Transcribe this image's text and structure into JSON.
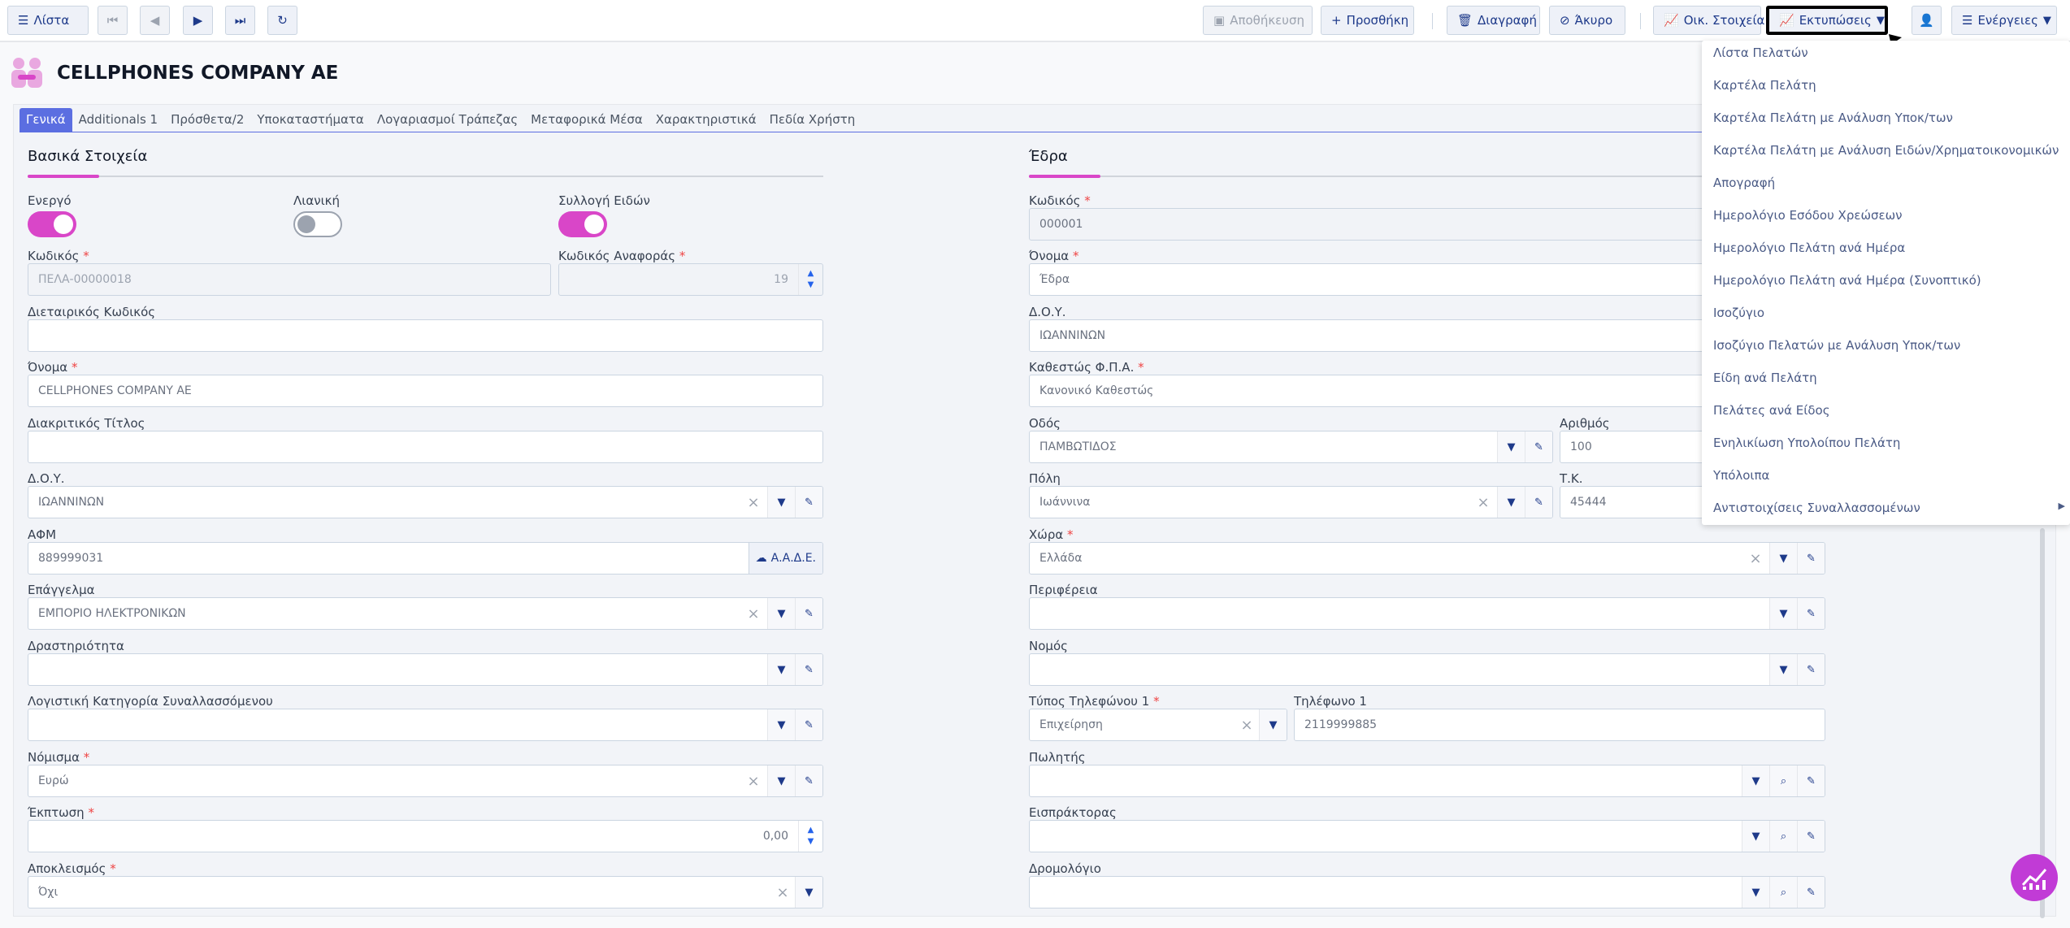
{
  "toolbar": {
    "list_label": "Λίστα",
    "save_label": "Αποθήκευση",
    "add_label": "Προσθήκη",
    "delete_label": "Διαγραφή",
    "cancel_label": "Άκυρο",
    "financial_label": "Οικ. Στοιχεία",
    "prints_label": "Εκτυπώσεις",
    "actions_label": "Ενέργειες"
  },
  "header": {
    "title": "CELLPHONES COMPANY AE"
  },
  "tabs": [
    "Γενικά",
    "Additionals 1",
    "Πρόσθετα/2",
    "Υποκαταστήματα",
    "Λογαριασμοί Τράπεζας",
    "Μεταφορικά Μέσα",
    "Χαρακτηριστικά",
    "Πεδία Χρήστη"
  ],
  "basic": {
    "section_title": "Βασικά Στοιχεία",
    "active_label": "Ενεργό",
    "retail_label": "Λιανική",
    "collect_label": "Συλλογή Ειδών",
    "active_on": true,
    "retail_on": false,
    "collect_on": true,
    "code_label": "Κωδικός",
    "code_value": "ΠΕΛΑ-00000018",
    "refcode_label": "Κωδικός Αναφοράς",
    "refcode_value": "19",
    "intercode_label": "Διεταιρικός Κωδικός",
    "intercode_value": "",
    "name_label": "Όνομα",
    "name_value": "CELLPHONES COMPANY AE",
    "distinct_label": "Διακριτικός Τίτλος",
    "distinct_value": "",
    "doy_label": "Δ.Ο.Υ.",
    "doy_value": "ΙΩΑΝΝΙΝΩΝ",
    "afm_label": "ΑΦΜ",
    "afm_value": "889999031",
    "aade_label": "Α.Α.Δ.Ε.",
    "profession_label": "Επάγγελμα",
    "profession_value": "ΕΜΠΟΡΙΟ ΗΛΕΚΤΡΟΝΙΚΩΝ",
    "activity_label": "Δραστηριότητα",
    "activity_value": "",
    "acc_cat_label": "Λογιστική Κατηγορία Συναλλασσόμενου",
    "acc_cat_value": "",
    "currency_label": "Νόμισμα",
    "currency_value": "Ευρώ",
    "discount_label": "Έκπτωση",
    "discount_value": "0,00",
    "exclusion_label": "Αποκλεισμός",
    "exclusion_value": "Όχι"
  },
  "seat": {
    "section_title": "Έδρα",
    "code_label": "Κωδικός",
    "code_value": "000001",
    "name_label": "Όνομα",
    "name_value": "Έδρα",
    "doy_label": "Δ.Ο.Υ.",
    "doy_value": "ΙΩΑΝΝΙΝΩΝ",
    "vat_label": "Καθεστώς Φ.Π.Α.",
    "vat_value": "Κανονικό Καθεστώς",
    "street_label": "Οδός",
    "street_value": "ΠΑΜΒΩΤΙΔΟΣ",
    "number_label": "Αριθμός",
    "number_value": "100",
    "city_label": "Πόλη",
    "city_value": "Ιωάννινα",
    "zip_label": "Τ.Κ.",
    "zip_value": "45444",
    "country_label": "Χώρα",
    "country_value": "Ελλάδα",
    "region_label": "Περιφέρεια",
    "region_value": "",
    "prefecture_label": "Νομός",
    "prefecture_value": "",
    "phone_type_label": "Τύπος Τηλεφώνου 1",
    "phone_type_value": "Επιχείρηση",
    "phone_label": "Τηλέφωνο 1",
    "phone_value": "2119999885",
    "seller_label": "Πωλητής",
    "seller_value": "",
    "collector_label": "Εισπράκτορας",
    "collector_value": "",
    "route_label": "Δρομολόγιο",
    "route_value": ""
  },
  "print_menu": {
    "items": [
      "Λίστα Πελατών",
      "Καρτέλα Πελάτη",
      "Καρτέλα Πελάτη με Ανάλυση Υποκ/των",
      "Καρτέλα Πελάτη με Ανάλυση Ειδών/Χρηματοικονομικών",
      "Απογραφή",
      "Ημερολόγιο Εσόδου Χρεώσεων",
      "Ημερολόγιο Πελάτη ανά Ημέρα",
      "Ημερολόγιο Πελάτη ανά Ημέρα (Συνοπτικό)",
      "Ισοζύγιο",
      "Ισοζύγιο Πελατών με Ανάλυση Υποκ/των",
      "Είδη ανά Πελάτη",
      "Πελάτες ανά Είδος",
      "Ενηλικίωση Υπολοίπου Πελάτη",
      "Υπόλοιπα",
      "Αντιστοιχίσεις Συναλλασσομένων"
    ]
  },
  "colors": {
    "accent": "#d946c8",
    "primary": "#5b6ee1",
    "link": "#1e3a8a"
  },
  "icons": {
    "list": "list-icon",
    "first": "first-page-icon",
    "prev": "prev-icon",
    "next": "next-icon",
    "last": "last-page-icon",
    "refresh": "refresh-icon",
    "app": "handshake-icon",
    "fab": "chart-icon"
  }
}
